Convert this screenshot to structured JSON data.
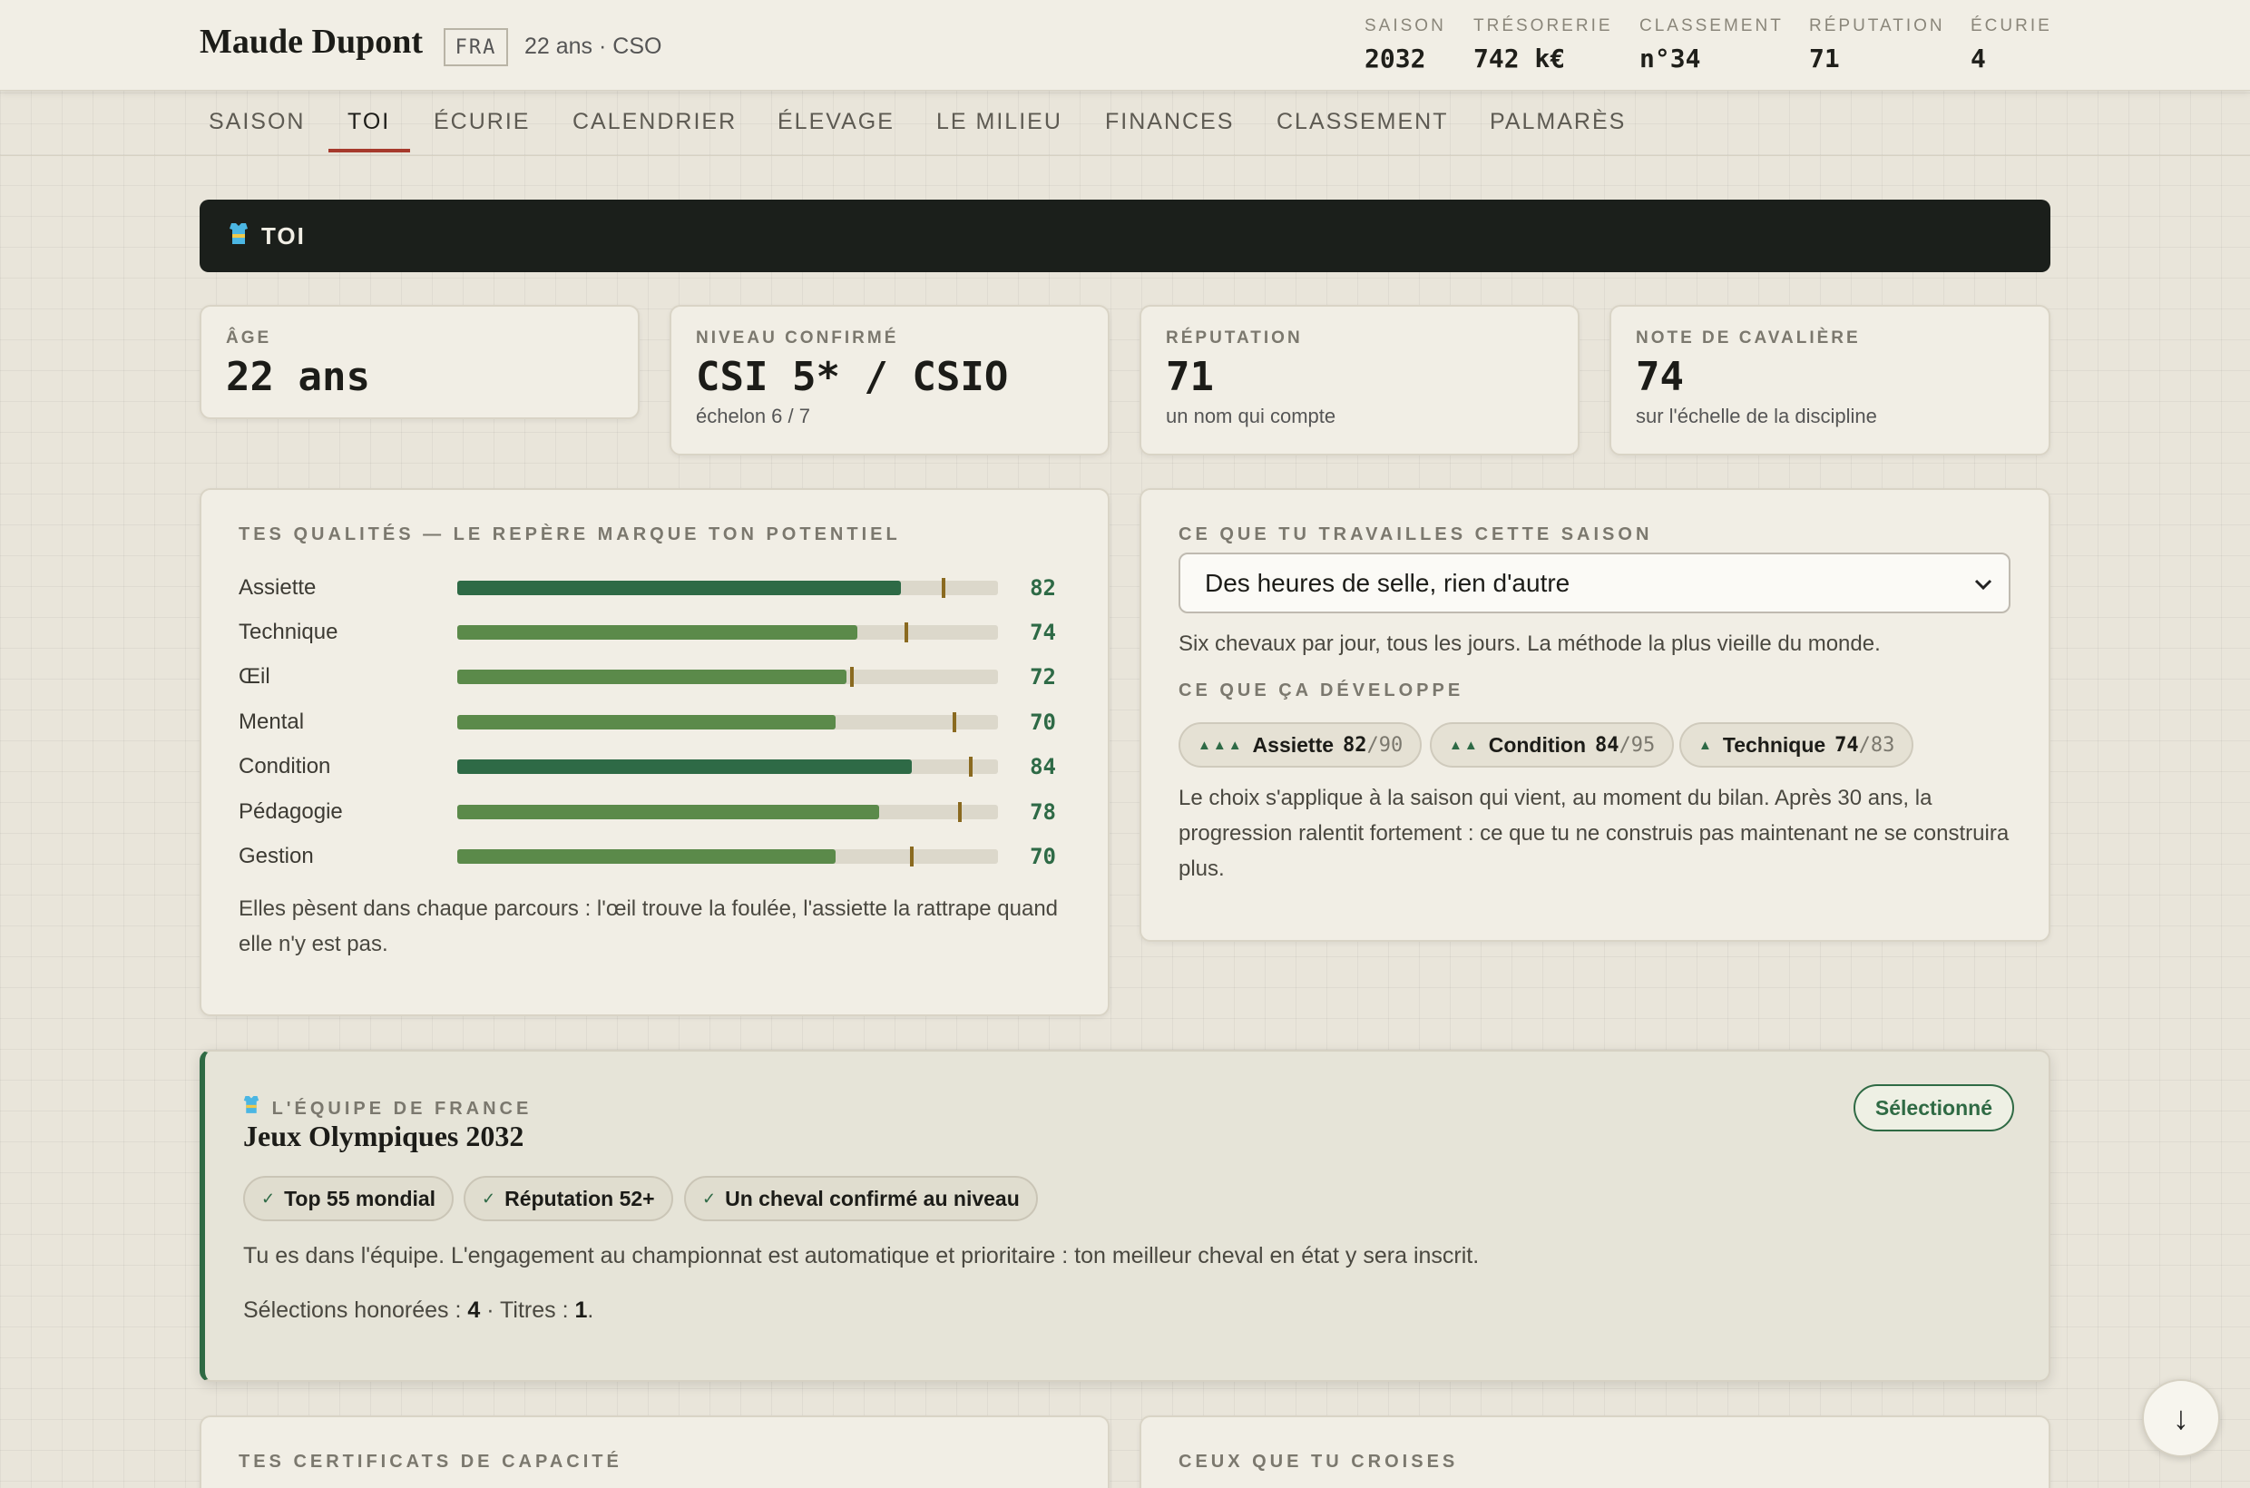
{
  "header": {
    "name": "Maude Dupont",
    "nationality": "FRA",
    "meta": "22 ans · CSO",
    "stats": [
      {
        "label": "SAISON",
        "value": "2032"
      },
      {
        "label": "TRÉSORERIE",
        "value": "742 k€"
      },
      {
        "label": "CLASSEMENT",
        "value": "n°34"
      },
      {
        "label": "RÉPUTATION",
        "value": "71"
      },
      {
        "label": "ÉCURIE",
        "value": "4"
      }
    ]
  },
  "nav": {
    "tabs": [
      "SAISON",
      "TOI",
      "ÉCURIE",
      "CALENDRIER",
      "ÉLEVAGE",
      "LE MILIEU",
      "FINANCES",
      "CLASSEMENT",
      "PALMARÈS"
    ],
    "active": "TOI"
  },
  "banner": {
    "icon": "jersey-icon",
    "title": "TOI"
  },
  "kpis": [
    {
      "label": "ÂGE",
      "value": "22 ans",
      "sub": ""
    },
    {
      "label": "NIVEAU CONFIRMÉ",
      "value": "CSI 5* / CSIO",
      "sub": "échelon 6 / 7"
    },
    {
      "label": "RÉPUTATION",
      "value": "71",
      "sub": "un nom qui compte"
    },
    {
      "label": "NOTE DE CAVALIÈRE",
      "value": "74",
      "sub": "sur l'échelle de la discipline"
    }
  ],
  "qualities": {
    "title": "TES QUALITÉS — LE REPÈRE MARQUE TON POTENTIEL",
    "items": [
      {
        "name": "Assiette",
        "value": 82,
        "value_label": "82",
        "potential": 90,
        "color": "#2e6a46"
      },
      {
        "name": "Technique",
        "value": 74,
        "value_label": "74",
        "potential": 83,
        "color": "#5b8a4a"
      },
      {
        "name": "Œil",
        "value": 72,
        "value_label": "72",
        "potential": 73,
        "color": "#5b8a4a"
      },
      {
        "name": "Mental",
        "value": 70,
        "value_label": "70",
        "potential": 92,
        "color": "#5b8a4a"
      },
      {
        "name": "Condition",
        "value": 84,
        "value_label": "84",
        "potential": 95,
        "color": "#2e6a46"
      },
      {
        "name": "Pédagogie",
        "value": 78,
        "value_label": "78",
        "potential": 93,
        "color": "#5b8a4a"
      },
      {
        "name": "Gestion",
        "value": 70,
        "value_label": "70",
        "potential": 84,
        "color": "#5b8a4a"
      }
    ],
    "footer": "Elles pèsent dans chaque parcours : l'œil trouve la foulée, l'assiette la rattrape quand elle n'y est pas."
  },
  "training": {
    "title": "CE QUE TU TRAVAILLES CETTE SAISON",
    "selected": "Des heures de selle, rien d'autre",
    "description": "Six chevaux par jour, tous les jours. La méthode la plus vieille du monde.",
    "develops_title": "CE QUE ÇA DÉVELOPPE",
    "develops": [
      {
        "arrows": "▲▲▲",
        "name": "Assiette",
        "current": "82",
        "max": "90"
      },
      {
        "arrows": "▲▲",
        "name": "Condition",
        "current": "84",
        "max": "95"
      },
      {
        "arrows": "▲",
        "name": "Technique",
        "current": "74",
        "max": "83"
      }
    ],
    "note": "Le choix s'applique à la saison qui vient, au moment du bilan. Après 30 ans, la progression ralentit fortement : ce que tu ne construis pas maintenant ne se construira plus."
  },
  "team": {
    "label": "L'ÉQUIPE DE FRANCE",
    "title": "Jeux Olympiques 2032",
    "badge": "Sélectionné",
    "requirements": [
      "Top 55 mondial",
      "Réputation 52+",
      "Un cheval confirmé au niveau"
    ],
    "text": "Tu es dans l'équipe. L'engagement au championnat est automatique et prioritaire : ton meilleur cheval en état y sera inscrit.",
    "selections_label": "Sélections honorées : ",
    "selections": "4",
    "titles_label": " · Titres : ",
    "titles": "1",
    "end": "."
  },
  "bottom_cards": {
    "certificates_title": "TES CERTIFICATS DE CAPACITÉ",
    "encounters_title": "CEUX QUE TU CROISES"
  },
  "scroll_button": {
    "glyph": "↓"
  }
}
